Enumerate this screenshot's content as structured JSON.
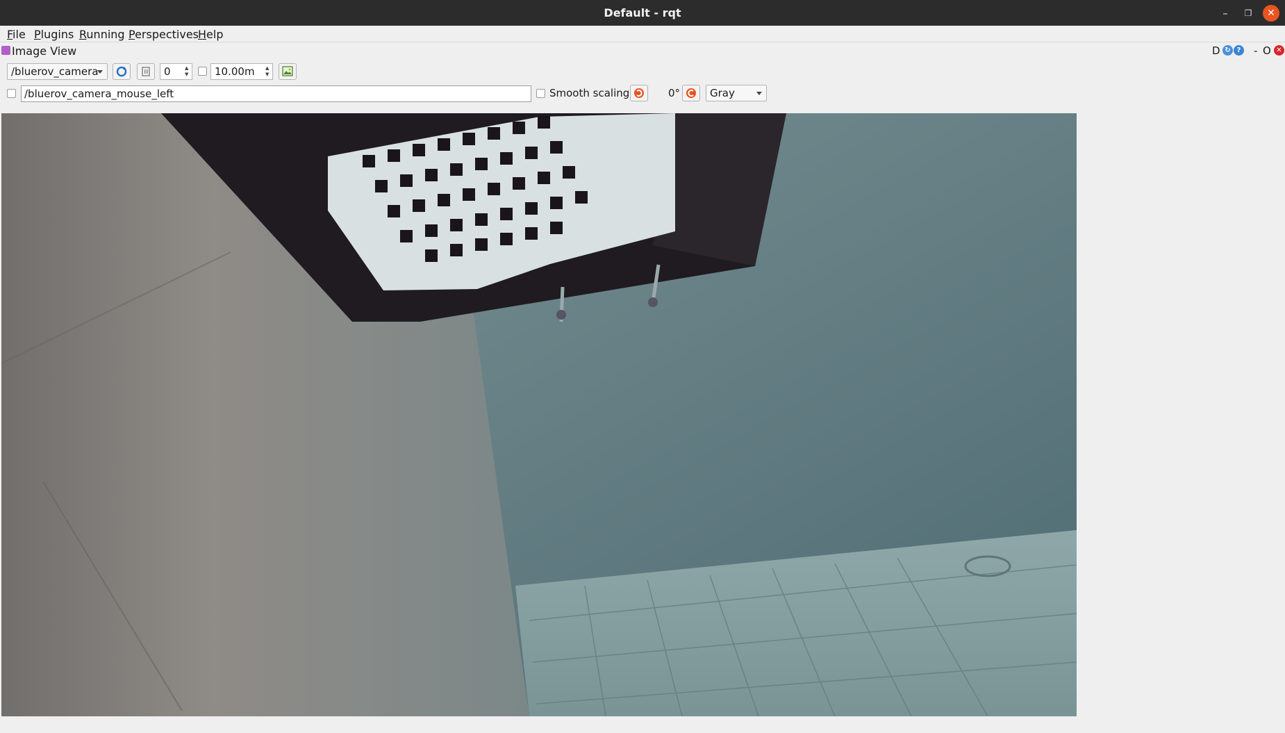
{
  "window": {
    "title": "Default - rqt"
  },
  "menu": [
    "File",
    "Plugins",
    "Running",
    "Perspectives",
    "Help"
  ],
  "plugin": {
    "title": "Image View",
    "dock_buttons": [
      "D",
      "-",
      "O"
    ]
  },
  "toolbar": {
    "topic": "/bluerov_camera",
    "spin_value": "0",
    "length_value": "10.00m"
  },
  "toolbar2": {
    "mouse_topic": "/bluerov_camera_mouse_left",
    "smooth_scaling_label": "Smooth scaling",
    "rotation_label": "0°",
    "color_scheme": "Gray"
  },
  "colors": {
    "titlebar": "#2c2c2c",
    "close_button": "#e95420",
    "accent_rotate": "#e95420"
  }
}
